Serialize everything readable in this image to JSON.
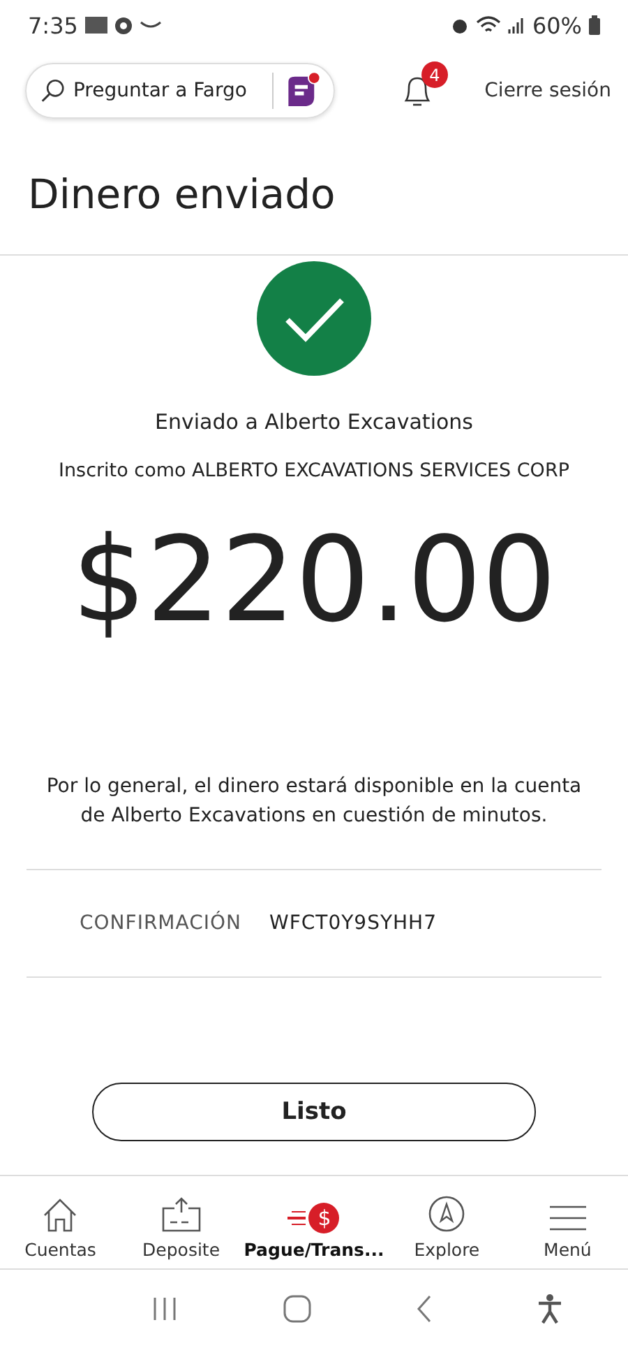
{
  "status_bar": {
    "time": "7:35",
    "battery": "60%"
  },
  "header": {
    "search": {
      "placeholder": "Preguntar a Fargo"
    },
    "notifications": {
      "count": "4"
    },
    "logout": "Cierre sesión"
  },
  "title": "Dinero enviado",
  "confirmation": {
    "sent_to": "Enviado a Alberto Excavations",
    "registered_as": "Inscrito como ALBERTO EXCAVATIONS SERVICES CORP",
    "amount": "$220.00",
    "note": "Por lo general, el dinero estará disponible en la cuenta de Alberto Excavations en cuestión de minutos.",
    "label": "CONFIRMACIÓN",
    "code": "WFCT0Y9SYHH7"
  },
  "done_button": "Listo",
  "bottom_nav": [
    {
      "kind": "home",
      "label": "Cuentas",
      "selected": false
    },
    {
      "kind": "deposit",
      "label": "Deposite",
      "selected": false
    },
    {
      "kind": "pay",
      "label": "Pague/Trans...",
      "selected": true,
      "icon_text": "$"
    },
    {
      "kind": "explore",
      "label": "Explore",
      "selected": false
    },
    {
      "kind": "menu",
      "label": "Menú",
      "selected": false
    }
  ]
}
